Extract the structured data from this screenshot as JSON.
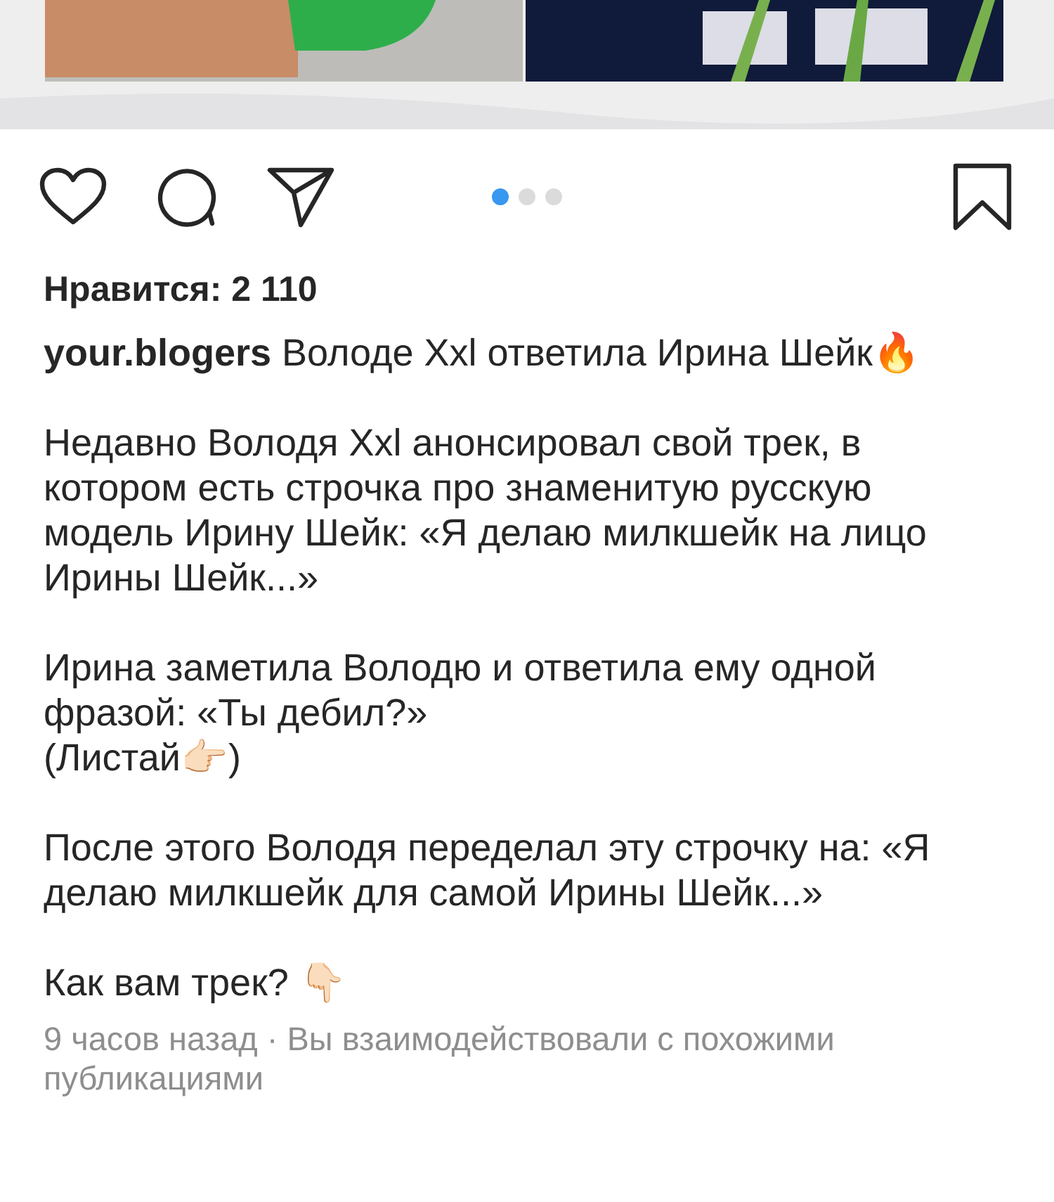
{
  "post": {
    "carousel_dots": [
      {
        "selected": true
      },
      {
        "selected": false
      },
      {
        "selected": false
      }
    ],
    "likes": "Нравится: 2 110",
    "username": "your.blogers",
    "caption_title": "Володе Xxl ответила Ирина Шейк🔥",
    "paragraphs": [
      {
        "lines": [
          "Недавно Володя Xxl анонсировал свой трек, в котором есть строчка про знаменитую русскую модель Ирину Шейк: «Я делаю милкшейк на лицо Ирины Шейк...»"
        ]
      },
      {
        "lines": [
          "Ирина заметила Володю и ответила ему одной фразой: «Ты дебил?»",
          "(Листай👉🏻)"
        ]
      },
      {
        "lines": [
          "После этого Володя переделал эту строчку на: «Я делаю милкшейк для самой Ирины Шейк...»"
        ]
      },
      {
        "lines": [
          "Как вам трек? 👇🏻"
        ]
      }
    ],
    "meta": "9 часов назад · Вы взаимодействовали с похожими публикациями"
  }
}
